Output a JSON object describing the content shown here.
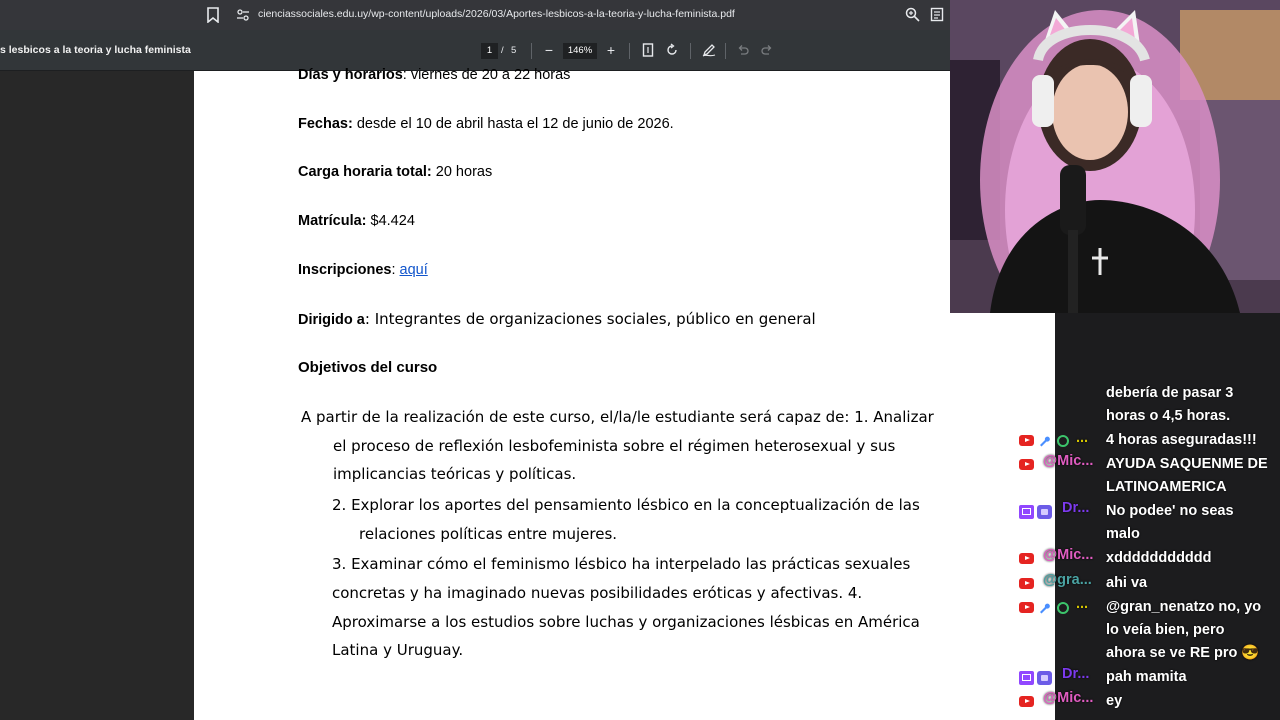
{
  "browser": {
    "url": "cienciassociales.edu.uy/wp-content/uploads/2026/03/Aportes-lesbicos-a-la-teoria-y-lucha-feminista.pdf"
  },
  "pdf_toolbar": {
    "title": "s lesbicos a la teoria y lucha feminista",
    "current_page": "1",
    "separator": "/",
    "total_pages": "5",
    "zoom_out": "−",
    "zoom": "146%",
    "zoom_in": "+"
  },
  "document": {
    "dias_label": "Días y horarios",
    "dias_value": ": viernes de 20 a 22 horas",
    "fechas_label": "Fechas:",
    "fechas_value": " desde el 10 de abril hasta el 12 de junio de 2026.",
    "carga_label": "Carga horaria total:",
    "carga_value": " 20 horas",
    "matricula_label": "Matrícula:",
    "matricula_value": " $4.424",
    "inscripciones_label": "Inscripciones",
    "inscripciones_colon": ": ",
    "inscripciones_link": "aquí",
    "dirigido_label": "Dirigido a",
    "dirigido_value": ": Integrantes de organizaciones sociales, público en general",
    "objetivos_heading": "Objetivos del curso",
    "objetivos_lines": [
      "A partir de la realización de este curso, el/la/le estudiante será capaz de: 1. Analizar",
      "el proceso de reflexión lesbofeminista sobre el régimen heterosexual y sus",
      "implicancias teóricas y políticas.",
      "2. Explorar los aportes del pensamiento lésbico en la conceptualización de las",
      "relaciones políticas entre mujeres.",
      "3. Examinar cómo el feminismo lésbico ha interpelado las prácticas sexuales",
      "concretas y ha imaginado nuevas posibilidades eróticas y afectivas. 4.",
      "Aproximarse a los estudios sobre luchas y organizaciones lésbicas en América",
      "Latina y Uruguay."
    ]
  },
  "chat": {
    "messages": [
      {
        "platform": "none",
        "user": "",
        "lines": [
          "debería de pasar 3",
          "horas o 4,5 horas."
        ]
      },
      {
        "platform": "youtube",
        "user": "...",
        "lines": [
          "4 horas aseguradas!!!"
        ]
      },
      {
        "platform": "youtube",
        "user": "@Mic...",
        "lines": [
          "AYUDA SAQUENME DE",
          "LATINOAMERICA"
        ]
      },
      {
        "platform": "twitch",
        "user": "Dr...",
        "lines": [
          "No podee' no seas",
          "malo"
        ]
      },
      {
        "platform": "youtube",
        "user": "@Mic...",
        "lines": [
          "xddddddddddd"
        ]
      },
      {
        "platform": "youtube",
        "user": "@gra...",
        "lines": [
          "ahi va"
        ]
      },
      {
        "platform": "youtube",
        "user": "...",
        "lines": [
          "@gran_nenatzo no, yo",
          "lo veía bien, pero",
          "ahora se ve RE pro 😎"
        ]
      },
      {
        "platform": "twitch",
        "user": "Dr...",
        "lines": [
          "pah mamita"
        ]
      },
      {
        "platform": "youtube",
        "user": "@Mic...",
        "lines": [
          "ey"
        ]
      }
    ]
  },
  "colors": {
    "link": "#1155cc",
    "youtube_user": "#e05cc1",
    "twitch_user": "#7c3aed",
    "gra_user": "#4aa3a3",
    "dots_user": "#d4c400"
  }
}
